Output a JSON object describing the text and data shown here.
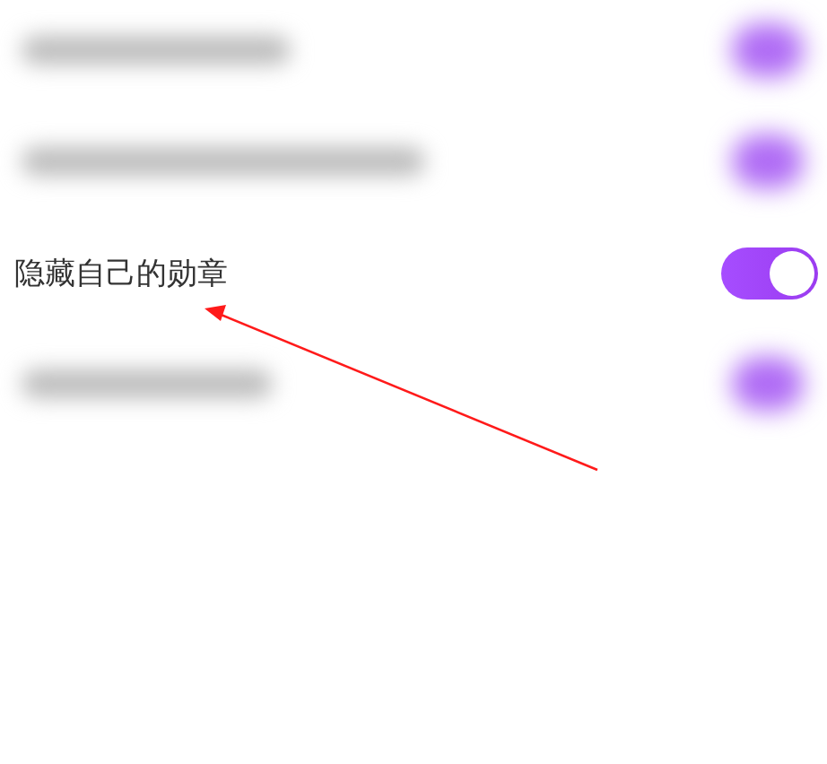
{
  "settings": [
    {
      "kind": "blurred",
      "on": true
    },
    {
      "kind": "blurred",
      "on": true
    },
    {
      "kind": "text",
      "label": "隐藏自己的勋章",
      "on": true
    },
    {
      "kind": "blurred",
      "on": true
    }
  ],
  "annotation": {
    "kind": "arrow"
  }
}
